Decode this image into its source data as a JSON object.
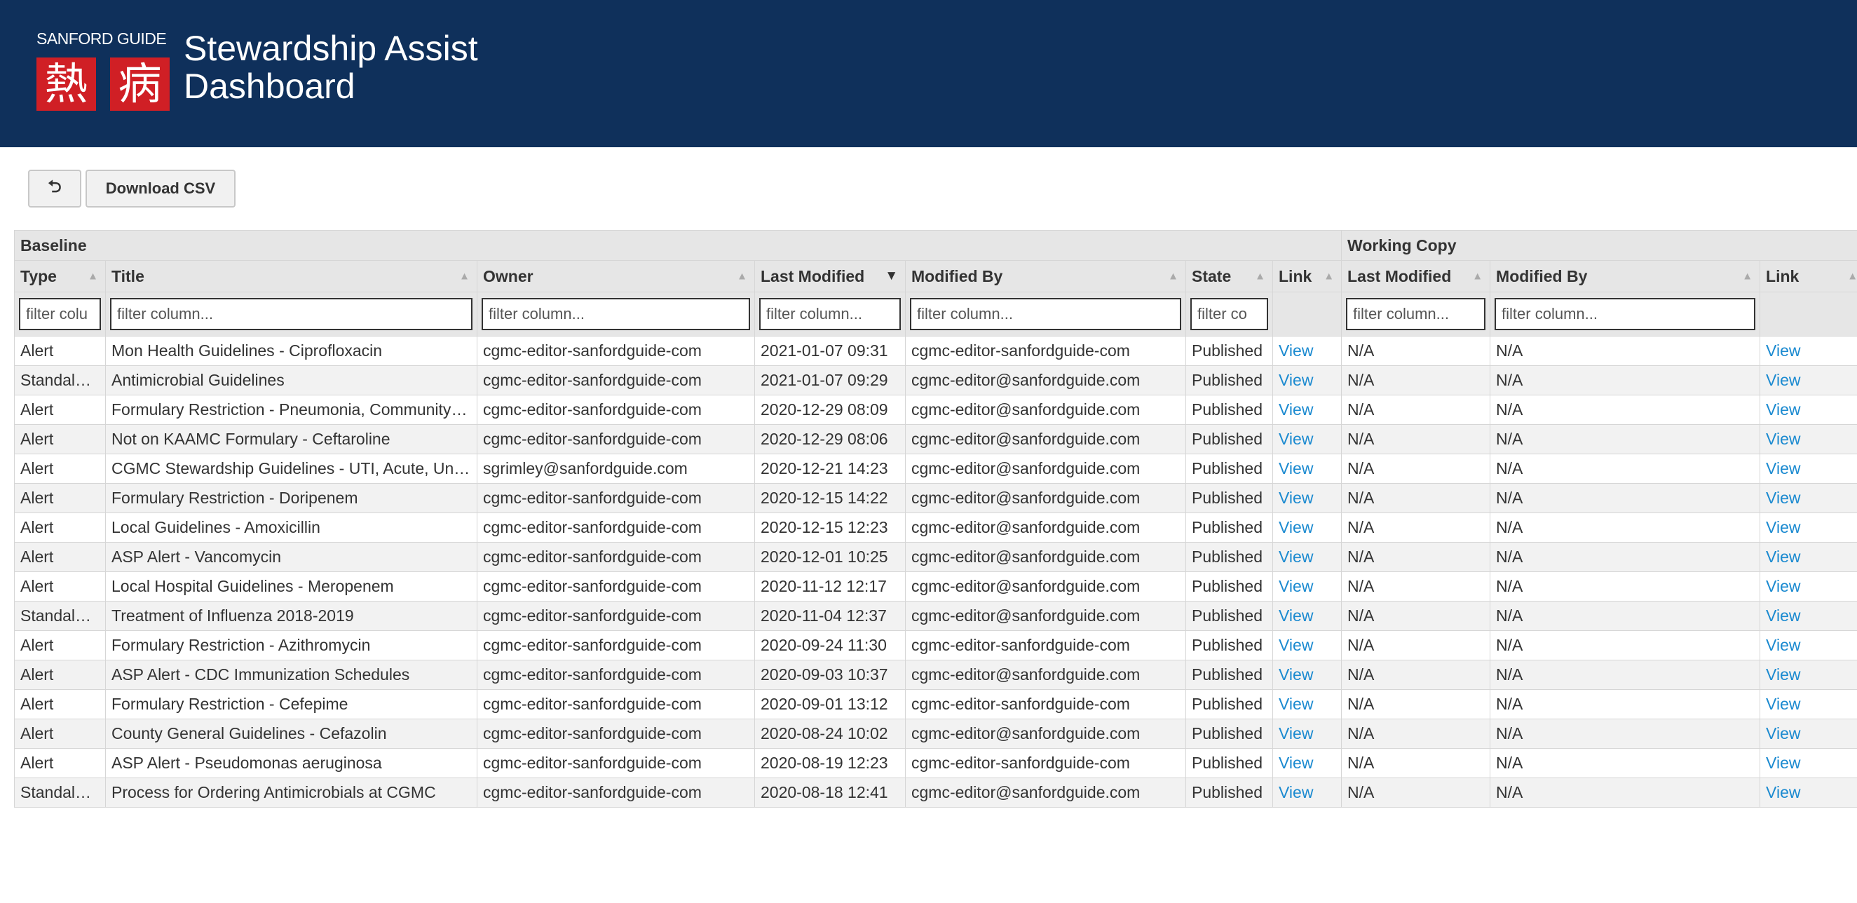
{
  "header": {
    "logo_brand": "SANFORD GUIDE",
    "logo_glyph_1": "熱",
    "logo_glyph_2": "病",
    "title_line1": "Stewardship Assist",
    "title_line2": "Dashboard",
    "background_color": "#0f305b",
    "logo_color": "#d01f25"
  },
  "toolbar": {
    "logout_icon": "sign-in-icon",
    "logout_glyph": "⮌",
    "download_label": "Download CSV"
  },
  "grid": {
    "group_headers": {
      "baseline": "Baseline",
      "working_copy": "Working Copy"
    },
    "columns": {
      "type": "Type",
      "title": "Title",
      "owner": "Owner",
      "last_modified": "Last Modified",
      "modified_by": "Modified By",
      "state": "State",
      "link": "Link",
      "wc_last_modified": "Last Modified",
      "wc_modified_by": "Modified By",
      "wc_link": "Link"
    },
    "sort": {
      "asc_glyph": "▲",
      "desc_glyph": "▼",
      "active_column": "last_modified"
    },
    "filter_placeholder": "filter column...",
    "filter_placeholder_short_type": "filter colu",
    "filter_placeholder_short_state": "filter co",
    "link_color": "#1b8ad0",
    "rows": [
      {
        "type": "Alert",
        "title": "Mon Health Guidelines - Ciprofloxacin",
        "owner": "cgmc-editor-sanfordguide-com",
        "last_modified": "2021-01-07 09:31",
        "modified_by": "cgmc-editor-sanfordguide-com",
        "state": "Published",
        "link": "View",
        "wc_last_modified": "N/A",
        "wc_modified_by": "N/A",
        "wc_link": "View"
      },
      {
        "type": "Standalone",
        "title": "Antimicrobial Guidelines",
        "owner": "cgmc-editor-sanfordguide-com",
        "last_modified": "2021-01-07 09:29",
        "modified_by": "cgmc-editor@sanfordguide.com",
        "state": "Published",
        "link": "View",
        "wc_last_modified": "N/A",
        "wc_modified_by": "N/A",
        "wc_link": "View"
      },
      {
        "type": "Alert",
        "title": "Formulary Restriction - Pneumonia, Community-Acquired",
        "owner": "cgmc-editor-sanfordguide-com",
        "last_modified": "2020-12-29 08:09",
        "modified_by": "cgmc-editor@sanfordguide.com",
        "state": "Published",
        "link": "View",
        "wc_last_modified": "N/A",
        "wc_modified_by": "N/A",
        "wc_link": "View"
      },
      {
        "type": "Alert",
        "title": "Not on KAAMC Formulary - Ceftaroline",
        "owner": "cgmc-editor-sanfordguide-com",
        "last_modified": "2020-12-29 08:06",
        "modified_by": "cgmc-editor@sanfordguide.com",
        "state": "Published",
        "link": "View",
        "wc_last_modified": "N/A",
        "wc_modified_by": "N/A",
        "wc_link": "View"
      },
      {
        "type": "Alert",
        "title": "CGMC Stewardship Guidelines - UTI, Acute, Uncomplicated",
        "owner": "sgrimley@sanfordguide.com",
        "last_modified": "2020-12-21 14:23",
        "modified_by": "cgmc-editor@sanfordguide.com",
        "state": "Published",
        "link": "View",
        "wc_last_modified": "N/A",
        "wc_modified_by": "N/A",
        "wc_link": "View"
      },
      {
        "type": "Alert",
        "title": "Formulary Restriction - Doripenem",
        "owner": "cgmc-editor-sanfordguide-com",
        "last_modified": "2020-12-15 14:22",
        "modified_by": "cgmc-editor@sanfordguide.com",
        "state": "Published",
        "link": "View",
        "wc_last_modified": "N/A",
        "wc_modified_by": "N/A",
        "wc_link": "View"
      },
      {
        "type": "Alert",
        "title": "Local Guidelines - Amoxicillin",
        "owner": "cgmc-editor-sanfordguide-com",
        "last_modified": "2020-12-15 12:23",
        "modified_by": "cgmc-editor@sanfordguide.com",
        "state": "Published",
        "link": "View",
        "wc_last_modified": "N/A",
        "wc_modified_by": "N/A",
        "wc_link": "View"
      },
      {
        "type": "Alert",
        "title": "ASP Alert - Vancomycin",
        "owner": "cgmc-editor-sanfordguide-com",
        "last_modified": "2020-12-01 10:25",
        "modified_by": "cgmc-editor@sanfordguide.com",
        "state": "Published",
        "link": "View",
        "wc_last_modified": "N/A",
        "wc_modified_by": "N/A",
        "wc_link": "View"
      },
      {
        "type": "Alert",
        "title": "Local Hospital Guidelines - Meropenem",
        "owner": "cgmc-editor-sanfordguide-com",
        "last_modified": "2020-11-12 12:17",
        "modified_by": "cgmc-editor@sanfordguide.com",
        "state": "Published",
        "link": "View",
        "wc_last_modified": "N/A",
        "wc_modified_by": "N/A",
        "wc_link": "View"
      },
      {
        "type": "Standalone",
        "title": "Treatment of Influenza 2018-2019",
        "owner": "cgmc-editor-sanfordguide-com",
        "last_modified": "2020-11-04 12:37",
        "modified_by": "cgmc-editor@sanfordguide.com",
        "state": "Published",
        "link": "View",
        "wc_last_modified": "N/A",
        "wc_modified_by": "N/A",
        "wc_link": "View"
      },
      {
        "type": "Alert",
        "title": "Formulary Restriction - Azithromycin",
        "owner": "cgmc-editor-sanfordguide-com",
        "last_modified": "2020-09-24 11:30",
        "modified_by": "cgmc-editor-sanfordguide-com",
        "state": "Published",
        "link": "View",
        "wc_last_modified": "N/A",
        "wc_modified_by": "N/A",
        "wc_link": "View"
      },
      {
        "type": "Alert",
        "title": "ASP Alert - CDC Immunization Schedules",
        "owner": "cgmc-editor-sanfordguide-com",
        "last_modified": "2020-09-03 10:37",
        "modified_by": "cgmc-editor@sanfordguide.com",
        "state": "Published",
        "link": "View",
        "wc_last_modified": "N/A",
        "wc_modified_by": "N/A",
        "wc_link": "View"
      },
      {
        "type": "Alert",
        "title": "Formulary Restriction - Cefepime",
        "owner": "cgmc-editor-sanfordguide-com",
        "last_modified": "2020-09-01 13:12",
        "modified_by": "cgmc-editor-sanfordguide-com",
        "state": "Published",
        "link": "View",
        "wc_last_modified": "N/A",
        "wc_modified_by": "N/A",
        "wc_link": "View"
      },
      {
        "type": "Alert",
        "title": "County General Guidelines - Cefazolin",
        "owner": "cgmc-editor-sanfordguide-com",
        "last_modified": "2020-08-24 10:02",
        "modified_by": "cgmc-editor@sanfordguide.com",
        "state": "Published",
        "link": "View",
        "wc_last_modified": "N/A",
        "wc_modified_by": "N/A",
        "wc_link": "View"
      },
      {
        "type": "Alert",
        "title": "ASP Alert - Pseudomonas aeruginosa",
        "owner": "cgmc-editor-sanfordguide-com",
        "last_modified": "2020-08-19 12:23",
        "modified_by": "cgmc-editor-sanfordguide-com",
        "state": "Published",
        "link": "View",
        "wc_last_modified": "N/A",
        "wc_modified_by": "N/A",
        "wc_link": "View"
      },
      {
        "type": "Standalone",
        "title": "Process for Ordering Antimicrobials at CGMC",
        "owner": "cgmc-editor-sanfordguide-com",
        "last_modified": "2020-08-18 12:41",
        "modified_by": "cgmc-editor@sanfordguide.com",
        "state": "Published",
        "link": "View",
        "wc_last_modified": "N/A",
        "wc_modified_by": "N/A",
        "wc_link": "View"
      }
    ]
  }
}
